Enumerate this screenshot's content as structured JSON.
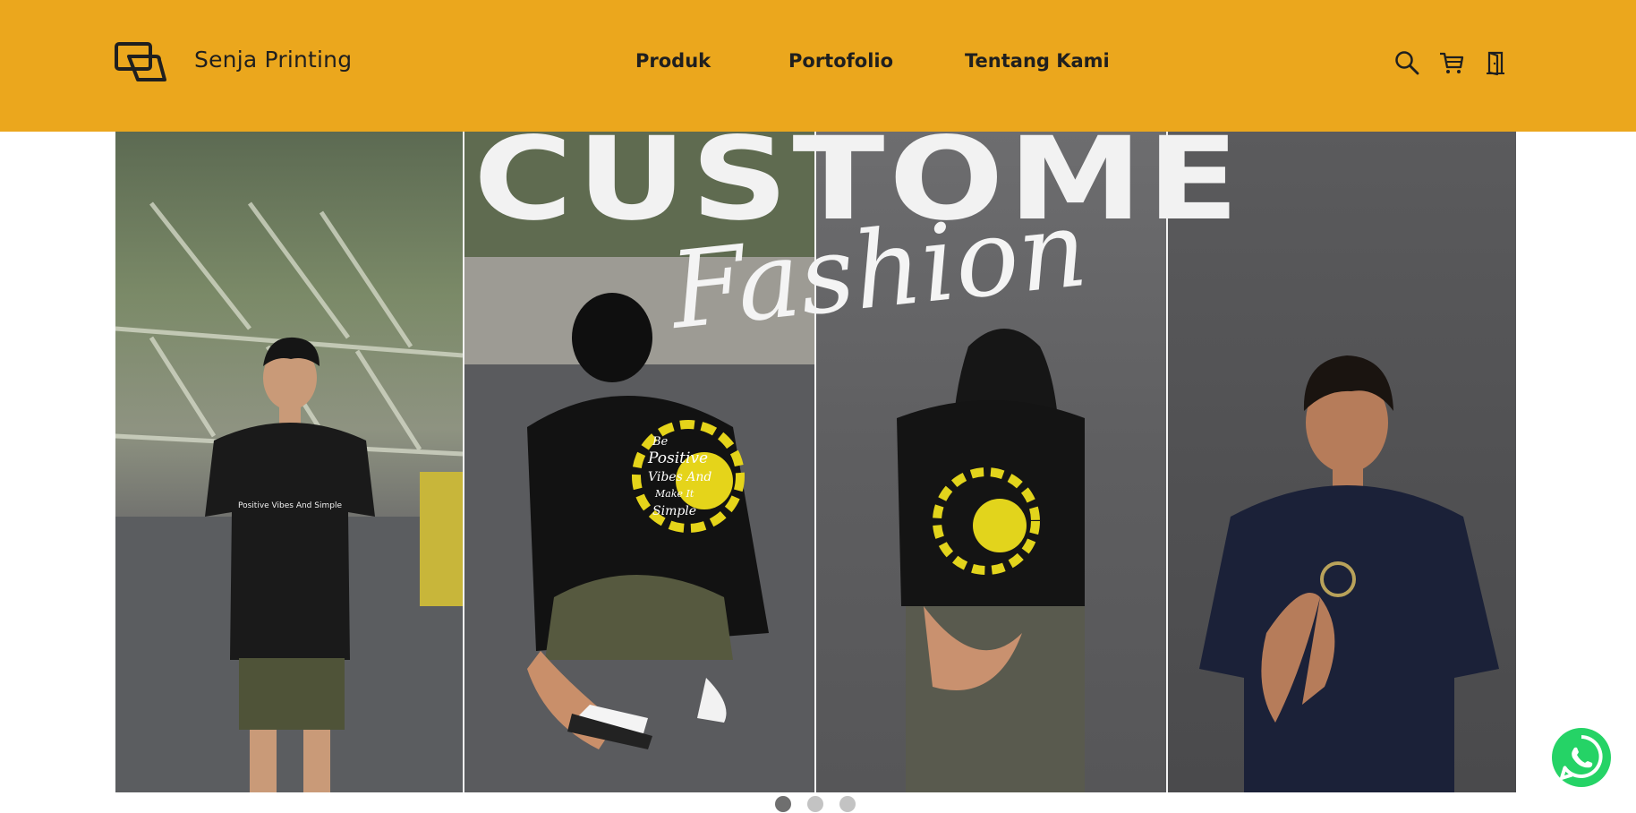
{
  "header": {
    "brand": "Senja Printing",
    "logo_icon": "logo-icon",
    "nav": [
      "Produk",
      "Portofolio",
      "Tentang Kami"
    ],
    "icons": [
      "search-icon",
      "cart-icon",
      "door-icon"
    ],
    "background": "#EBA71D"
  },
  "banner": {
    "headline": "CUSTOME",
    "subheadline": "Fashion",
    "shirt_texts": {
      "front": "Positive Vibes And Simple",
      "back": [
        "Be",
        "Positive",
        "Vibes And",
        "Make It",
        "Simple"
      ]
    }
  },
  "carousel": {
    "count": 3,
    "active": 1
  },
  "whatsapp": {
    "icon": "whatsapp-icon",
    "color": "#25D366"
  }
}
